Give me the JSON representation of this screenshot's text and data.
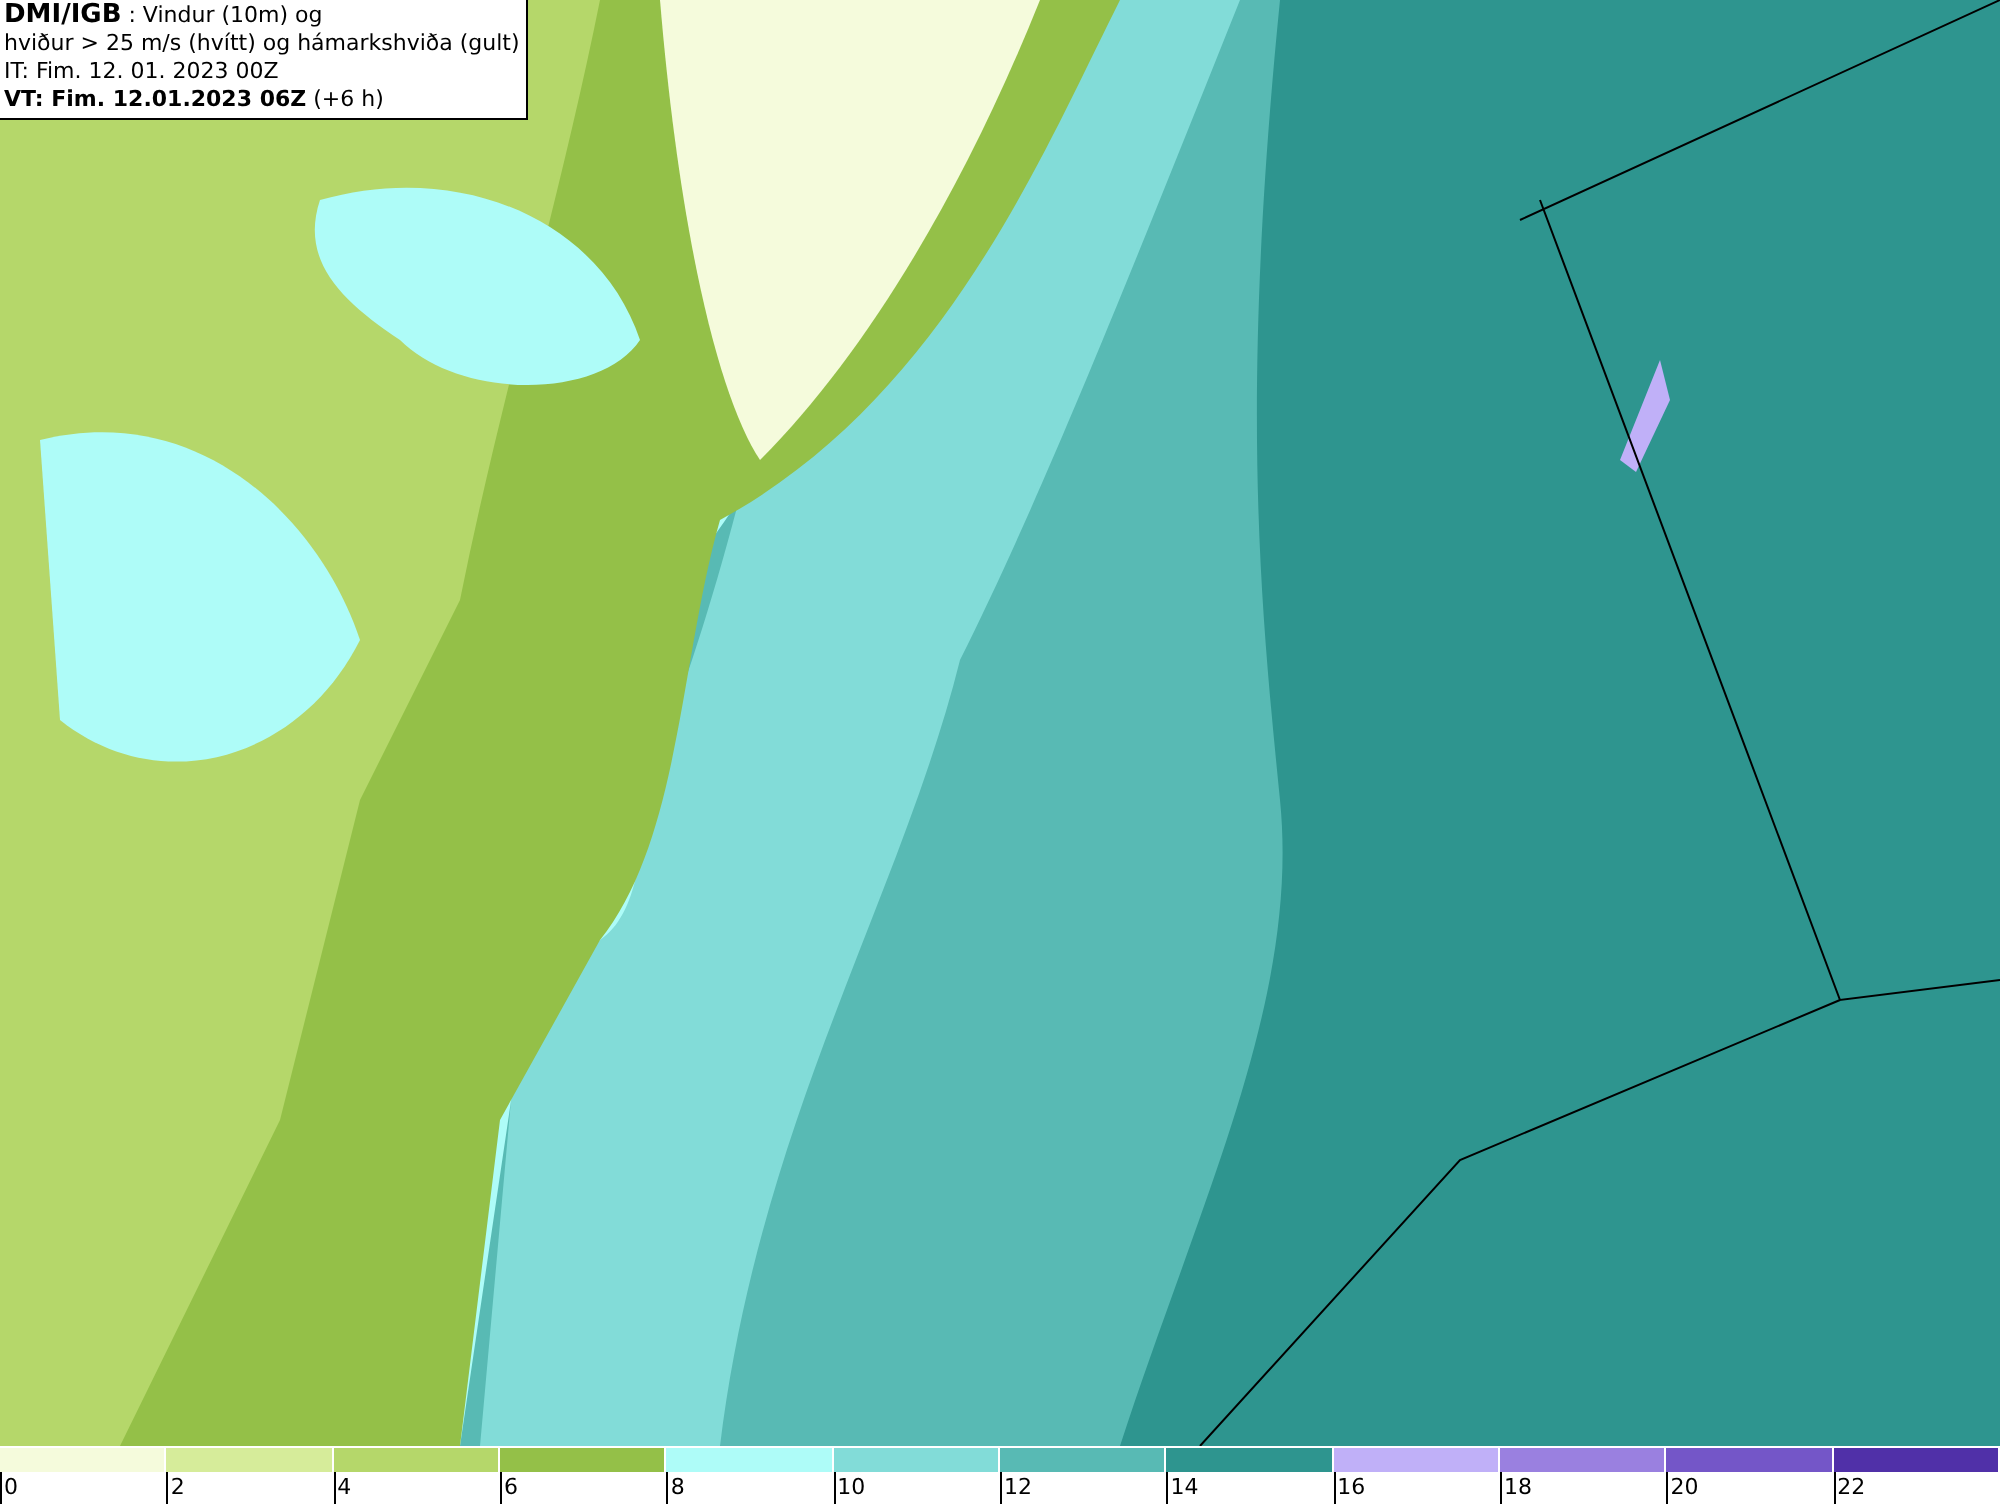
{
  "title_box": {
    "lines": [
      "**DMI/IGB** : Vindur (10m) og",
      "hviður > 25 m/s (hvítt) og hámarkshviða (gult)",
      "IT: Fim. 12. 01. 2023 00Z",
      "**VT: Fim. 12.01.2023 06Z** (+6 h)"
    ]
  },
  "legend": {
    "bins": [
      {
        "label": "0",
        "color": "#f5fbdc"
      },
      {
        "label": "2",
        "color": "#d6ec9a"
      },
      {
        "label": "4",
        "color": "#b5d76a"
      },
      {
        "label": "6",
        "color": "#94c048"
      },
      {
        "label": "8",
        "color": "#aefcf8"
      },
      {
        "label": "10",
        "color": "#82dcd8"
      },
      {
        "label": "12",
        "color": "#58bab4"
      },
      {
        "label": "14",
        "color": "#2e958f"
      },
      {
        "label": "16",
        "color": "#c0b0f8"
      },
      {
        "label": "18",
        "color": "#9a80e0"
      },
      {
        "label": "20",
        "color": "#7456c8"
      },
      {
        "label": "22",
        "color": "#5030a8"
      }
    ]
  }
}
